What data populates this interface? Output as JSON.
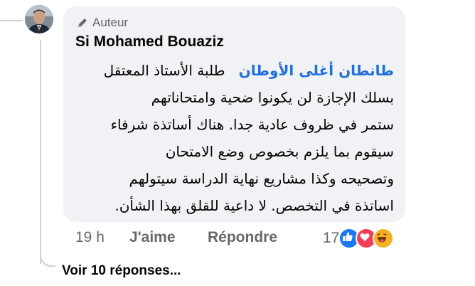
{
  "comment": {
    "badge": "Auteur",
    "author": "Si Mohamed Bouaziz",
    "mention": "طانطان أغلى الأوطان",
    "lines": [
      "طلبة الأستاذ المعتقل",
      "بسلك الإجازة  لن يكونوا ضحية وامتحاناتهم",
      "ستمر في ظروف عادية جدا. هناك أساتذة شرفاء",
      "سيقوم بما يلزم بخصوص وضع الامتحان",
      "وتصحيحه وكذا مشاريع نهاية الدراسة سيتولهم",
      "اساتذة في التخصص. لا داعية للقلق بهذا الشأن."
    ],
    "time": "19 h",
    "like_label": "J'aime",
    "reply_label": "Répondre",
    "reactions_count": "17",
    "reaction_icons": [
      "like-reaction-icon",
      "love-reaction-icon",
      "haha-reaction-icon"
    ]
  },
  "replies": {
    "label": "Voir 10 réponses..."
  },
  "colors": {
    "bubble": "#f0f2f5",
    "mention": "#216fdb",
    "like": "#1877f2",
    "love": "#f33e58",
    "haha": "#f7b125"
  }
}
